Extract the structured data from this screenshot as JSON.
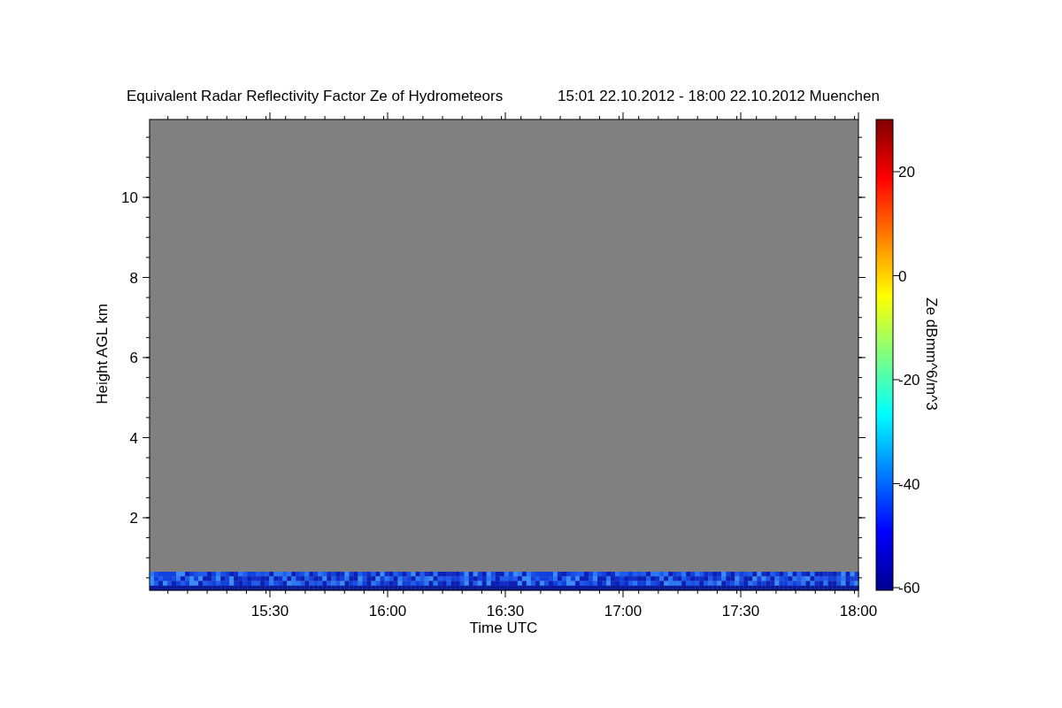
{
  "title": {
    "main": "Equivalent Radar Reflectivity Factor Ze of Hydrometeors",
    "period": "15:01 22.10.2012 - 18:00 22.10.2012 Muenchen"
  },
  "plot": {
    "xlabel": "Time UTC",
    "ylabel": "Height AGL km",
    "xticks": [
      "15:30",
      "16:00",
      "16:30",
      "17:00",
      "17:30",
      "18:00"
    ],
    "yticks": [
      "10",
      "8",
      "6",
      "4",
      "2"
    ]
  },
  "colorbar": {
    "label": "Ze dBmm^6/m^3",
    "ticks": [
      "20",
      "0",
      "-20",
      "-40",
      "-60"
    ]
  }
}
